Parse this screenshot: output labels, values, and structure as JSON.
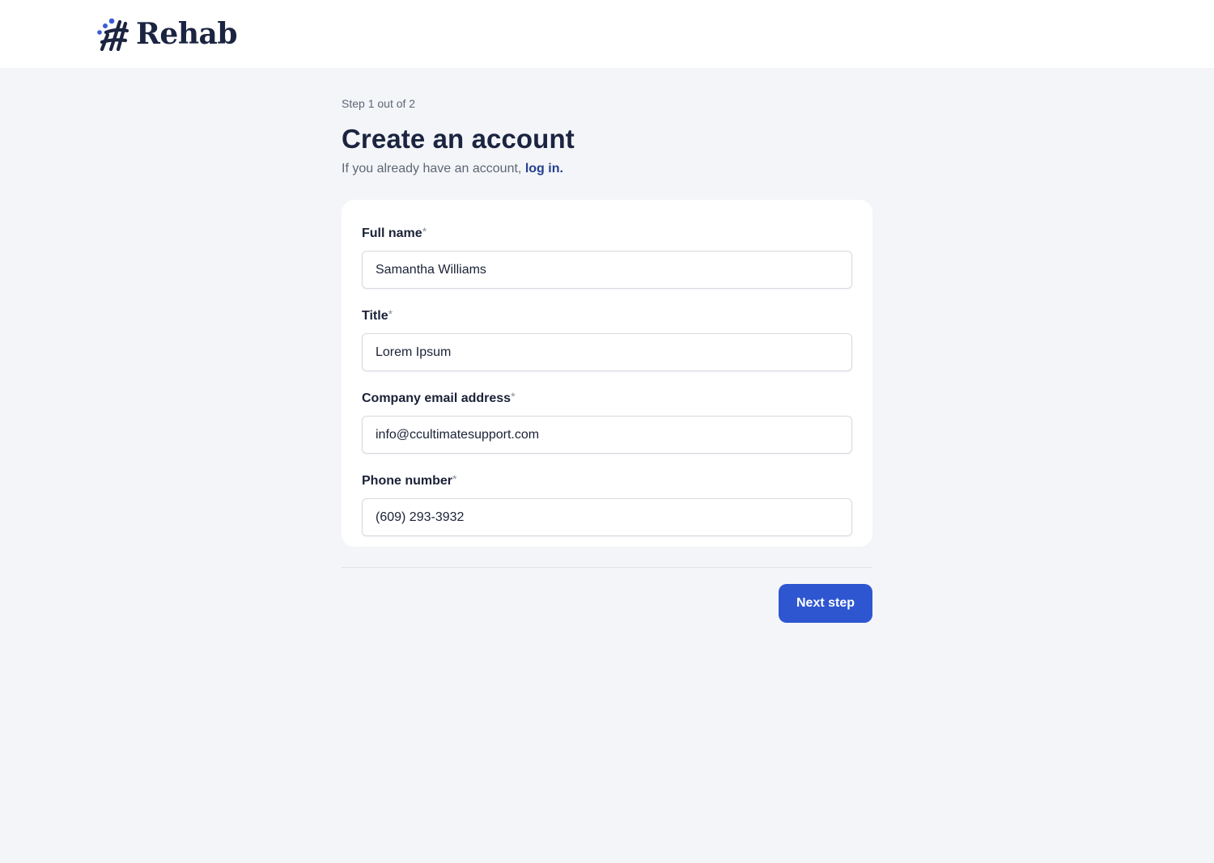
{
  "brand": {
    "name": "Rehab",
    "logo_icon": "rehab-hash-logo-icon",
    "logo_colors": {
      "dots": "#3b5bd6",
      "strokes": "#1b2440"
    }
  },
  "form": {
    "step": "Step 1 out of 2",
    "title": "Create an account",
    "subtitle_prefix": "If you already have an account,",
    "login_link": "log in.",
    "required_marker": "*",
    "fields": [
      {
        "label": "Full name",
        "value": "Samantha Williams"
      },
      {
        "label": "Title",
        "value": "Lorem Ipsum"
      },
      {
        "label": "Company email address",
        "value": "info@ccultimatesupport.com"
      },
      {
        "label": "Phone number",
        "value": "(609) 293-3932"
      }
    ],
    "next_label": "Next step"
  },
  "colors": {
    "accent": "#2e56d1",
    "link": "#26408f",
    "background": "#f3f5f8",
    "heading": "#1b2440"
  }
}
